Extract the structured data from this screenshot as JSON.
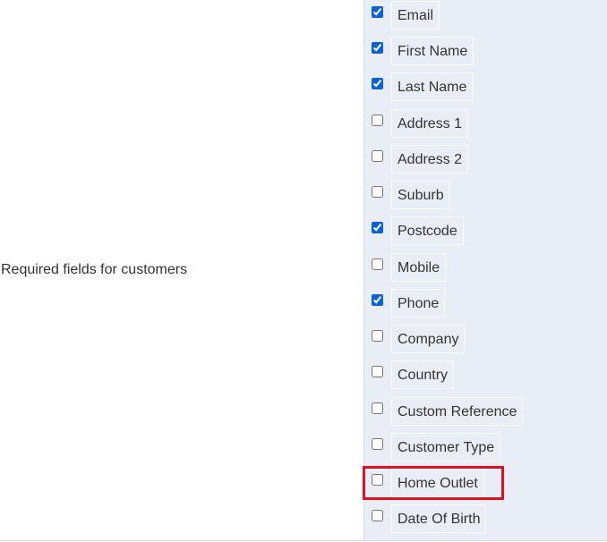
{
  "field_label": "Required fields for customers",
  "fields": [
    {
      "label": "Email",
      "checked": true
    },
    {
      "label": "First Name",
      "checked": true
    },
    {
      "label": "Last Name",
      "checked": true
    },
    {
      "label": "Address 1",
      "checked": false
    },
    {
      "label": "Address 2",
      "checked": false
    },
    {
      "label": "Suburb",
      "checked": false
    },
    {
      "label": "Postcode",
      "checked": true
    },
    {
      "label": "Mobile",
      "checked": false
    },
    {
      "label": "Phone",
      "checked": true
    },
    {
      "label": "Company",
      "checked": false
    },
    {
      "label": "Country",
      "checked": false
    },
    {
      "label": "Custom Reference",
      "checked": false
    },
    {
      "label": "Customer Type",
      "checked": false
    },
    {
      "label": "Home Outlet",
      "checked": false
    },
    {
      "label": "Date Of Birth",
      "checked": false
    }
  ],
  "highlighted_field": "Home Outlet",
  "colors": {
    "checkbox_accent": "#0b61d8",
    "highlight_border": "#e0101e",
    "panel_background": "#e9edf5"
  }
}
